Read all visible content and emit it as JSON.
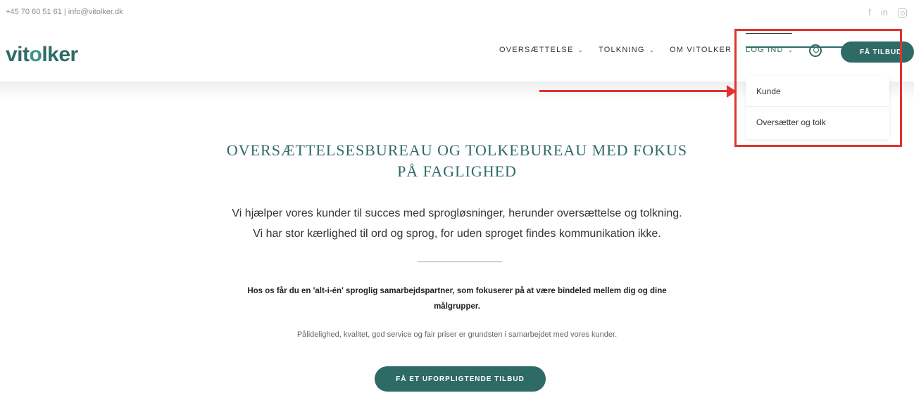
{
  "topbar": {
    "contact": "+45 70 60 51 61 | info@vitolker.dk",
    "social": {
      "facebook": "f",
      "linkedin": "in"
    }
  },
  "logo": {
    "part1": "vit",
    "part2": "o",
    "part3": "lker"
  },
  "nav": {
    "items": [
      {
        "label": "OVERSÆTTELSE",
        "has_dropdown": true
      },
      {
        "label": "TOLKNING",
        "has_dropdown": true
      },
      {
        "label": "OM VITOLKER",
        "has_dropdown": false
      },
      {
        "label": "LOG IND",
        "has_dropdown": true
      }
    ],
    "cta": "FÅ TILBUD"
  },
  "dropdown": {
    "items": [
      "Kunde",
      "Oversætter og tolk"
    ]
  },
  "hero": {
    "title_line1": "OVERSÆTTELSESBUREAU OG TOLKEBUREAU MED FOKUS",
    "title_line2": "PÅ FAGLIGHED",
    "intro_line1": "Vi hjælper vores kunder til succes med sprogløsninger, herunder oversættelse og tolkning.",
    "intro_line2": "Vi har stor kærlighed til ord og sprog, for uden sproget findes kommunikation ikke.",
    "bold_line1": "Hos os får du en 'alt-i-én' sproglig samarbejdspartner, som fokuserer på at være bindeled mellem dig og dine",
    "bold_line2": "målgrupper.",
    "small_text": "Pålidelighed, kvalitet, god service og fair priser er grundsten i samarbejdet med vores kunder.",
    "cta": "FÅ ET UFORPLIGTENDE TILBUD"
  },
  "colors": {
    "brand": "#2e6a66",
    "annotation": "#e0322f"
  }
}
